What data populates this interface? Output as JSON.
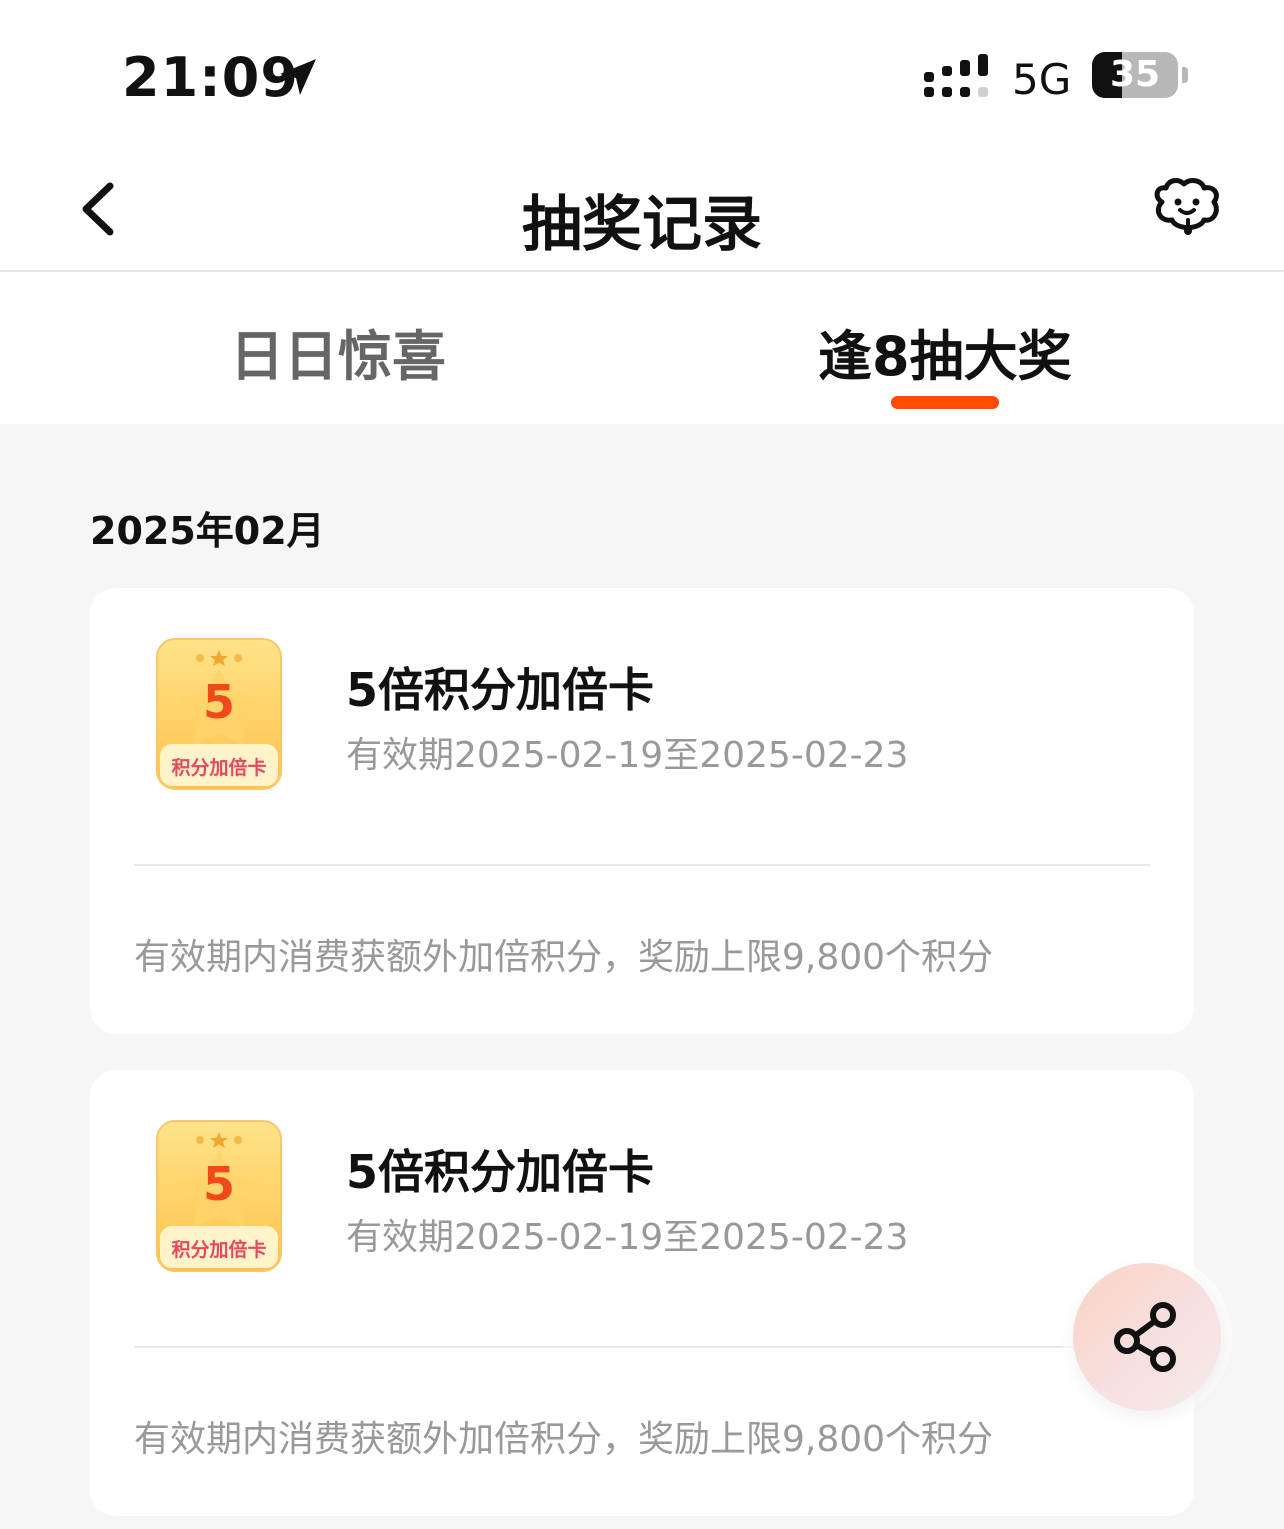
{
  "status_bar": {
    "time": "21:09",
    "network": "5G",
    "battery": "35",
    "battery_level": 0.35
  },
  "nav": {
    "title": "抽奖记录",
    "back_icon": "chevron-left-icon",
    "service_icon": "customer-service-icon"
  },
  "tabs": [
    {
      "label": "日日惊喜",
      "active": false
    },
    {
      "label": "逢8抽大奖",
      "active": true
    }
  ],
  "month": "2025年02月",
  "records": [
    {
      "badge_number": "5",
      "badge_text": "积分加倍卡",
      "name": "5倍积分加倍卡",
      "validity": "有效期2025-02-19至2025-02-23",
      "description": "有效期内消费获额外加倍积分，奖励上限9,800个积分"
    },
    {
      "badge_number": "5",
      "badge_text": "积分加倍卡",
      "name": "5倍积分加倍卡",
      "validity": "有效期2025-02-19至2025-02-23",
      "description": "有效期内消费获额外加倍积分，奖励上限9,800个积分"
    }
  ],
  "share_icon": "share-icon",
  "colors": {
    "accent": "#ff4a00",
    "background": "#f6f6f6",
    "muted_text": "#999999",
    "badge_number": "#f04a1c",
    "badge_text": "#e8485f"
  }
}
